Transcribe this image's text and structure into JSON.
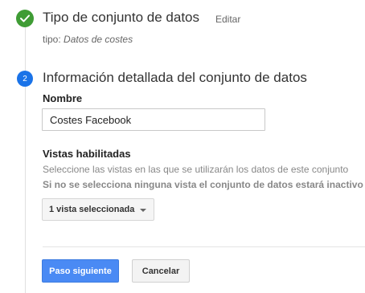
{
  "step1": {
    "title": "Tipo de conjunto de datos",
    "edit_label": "Editar",
    "type_prefix": "tipo:",
    "type_value": "Datos de costes",
    "status_color": "#3f9c35"
  },
  "step2": {
    "number": "2",
    "title": "Información detallada del conjunto de datos",
    "accent_color": "#1a73e8",
    "name_label": "Nombre",
    "name_value": "Costes Facebook",
    "views_label": "Vistas habilitadas",
    "views_description": "Seleccione las vistas en las que se utilizarán los datos de este conjunto",
    "views_warning": "Si no se selecciona ninguna vista el conjunto de datos estará inactivo",
    "views_select_value": "1 vista seleccionada"
  },
  "actions": {
    "next_label": "Paso siguiente",
    "cancel_label": "Cancelar"
  }
}
